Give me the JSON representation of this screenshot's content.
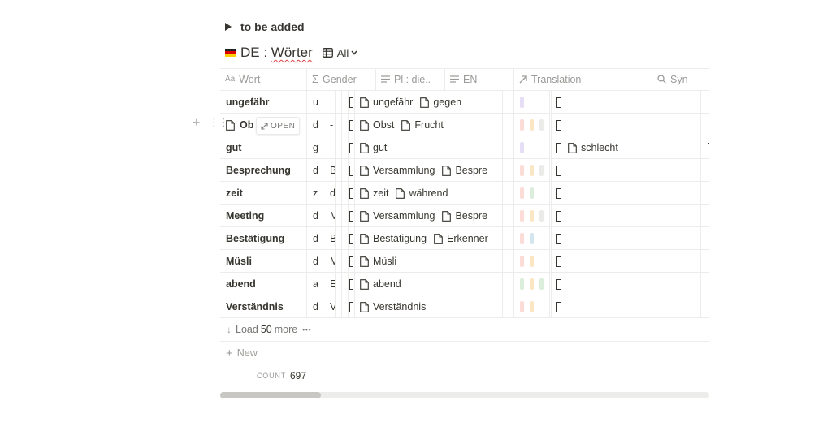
{
  "toggle": {
    "label": "to be added"
  },
  "database": {
    "title_prefix": "DE : ",
    "title_word": "Wörter",
    "view_label": "All"
  },
  "columns": [
    {
      "name": "Wort",
      "icon": "Aa"
    },
    {
      "name": "Gender",
      "icon": "sigma-icon"
    },
    {
      "name": "Pl : die..",
      "icon": "text-icon"
    },
    {
      "name": "EN",
      "icon": "text-icon"
    },
    {
      "name": "Translation",
      "icon": "arrow-up-right-icon"
    },
    {
      "name": "Syn",
      "icon": "search-icon"
    }
  ],
  "rows": [
    {
      "wort": "ungefähr",
      "gender": "u",
      "extra": "",
      "translations": [
        "ungefähr",
        "gegen"
      ],
      "syn": "",
      "tags": [
        "#e6def6"
      ]
    },
    {
      "wort": "Ob",
      "gender": "d",
      "extra": "-",
      "translations": [
        "Obst",
        "Frucht"
      ],
      "syn": "",
      "tags": [
        "#fbdcd6",
        "#fbe6c3",
        "#ebebea"
      ]
    },
    {
      "wort": "gut",
      "gender": "g",
      "extra": "",
      "translations": [
        "gut"
      ],
      "syn": "schlecht",
      "tags": [
        "#e6def6"
      ]
    },
    {
      "wort": "Besprechung",
      "gender": "d",
      "extra": "B",
      "translations": [
        "Versammlung",
        "Bespre"
      ],
      "syn": "",
      "tags": [
        "#fbdcd6",
        "#fbe6c3",
        "#ebebea"
      ]
    },
    {
      "wort": "zeit",
      "gender": "z",
      "extra": "d",
      "translations": [
        "zeit",
        "während"
      ],
      "syn": "",
      "tags": [
        "#fbdcd6",
        "#dbeddb"
      ]
    },
    {
      "wort": "Meeting",
      "gender": "d",
      "extra": "M",
      "translations": [
        "Versammlung",
        "Bespre"
      ],
      "syn": "",
      "tags": [
        "#fbdcd6",
        "#fbe6c3",
        "#ebebea"
      ]
    },
    {
      "wort": "Bestätigung",
      "gender": "d",
      "extra": "B",
      "translations": [
        "Bestätigung",
        "Erkenner"
      ],
      "syn": "",
      "tags": [
        "#fbdcd6",
        "#d3e5ef"
      ]
    },
    {
      "wort": "Müsli",
      "gender": "d",
      "extra": "M",
      "translations": [
        "Müsli"
      ],
      "syn": "",
      "tags": [
        "#fbdcd6",
        "#fbe6c3"
      ]
    },
    {
      "wort": "abend",
      "gender": "a",
      "extra": "E",
      "translations": [
        "abend"
      ],
      "syn": "",
      "tags": [
        "#dbeddb",
        "#fbe6c3",
        "#dbeddb"
      ]
    },
    {
      "wort": "Verständnis",
      "gender": "d",
      "extra": "V",
      "translations": [
        "Verständnis"
      ],
      "syn": "",
      "tags": [
        "#fbdcd6",
        "#fbe6c3"
      ]
    }
  ],
  "hover": {
    "open_label": "OPEN"
  },
  "footer": {
    "load_prefix": "Load",
    "load_count": "50",
    "load_suffix": "more",
    "more_dots": "•••",
    "new_label": "New",
    "count_label": "COUNT",
    "count_value": "697"
  }
}
